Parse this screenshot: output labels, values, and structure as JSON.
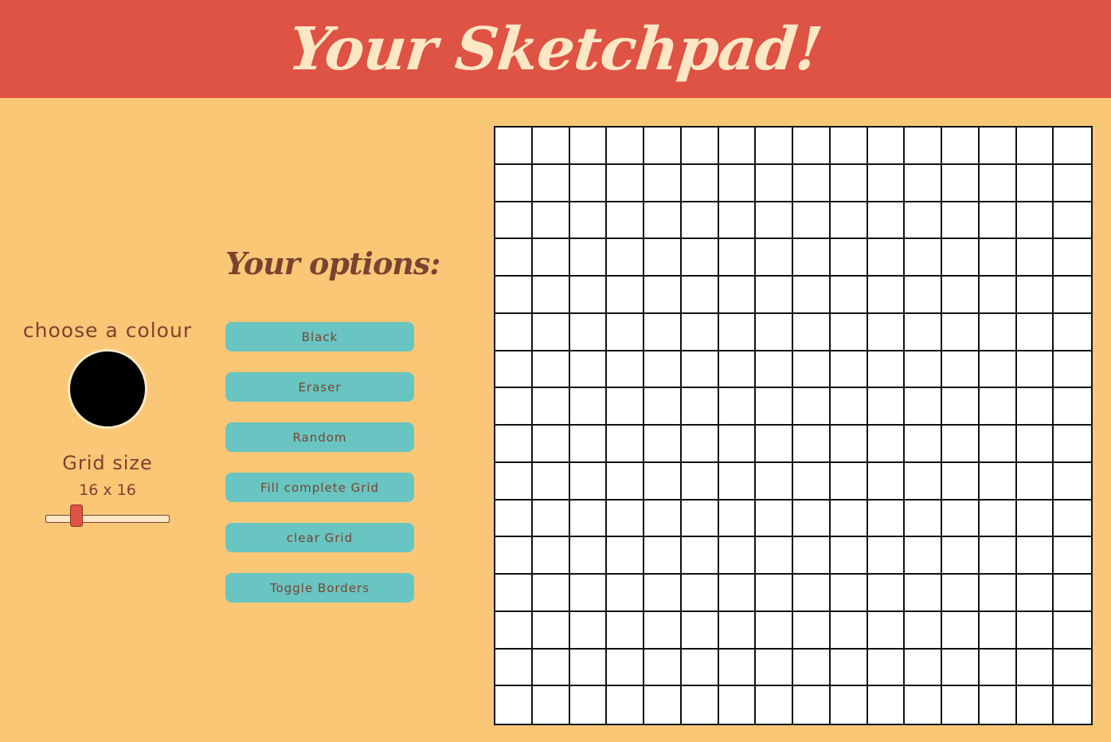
{
  "header": {
    "title": "Your Sketchpad!"
  },
  "colour_picker": {
    "label": "choose a colour",
    "value": "#000000"
  },
  "grid_size": {
    "label": "Grid size",
    "display": "16 x 16",
    "value": 16,
    "min": 1,
    "max": 64
  },
  "options": {
    "title": "Your options:",
    "buttons": [
      {
        "label": "Black"
      },
      {
        "label": "Eraser"
      },
      {
        "label": "Random"
      },
      {
        "label": "Fill complete Grid"
      },
      {
        "label": "clear Grid"
      },
      {
        "label": "Toggle Borders"
      }
    ]
  },
  "sketchpad": {
    "rows": 16,
    "cols": 16,
    "cell_color": "#ffffff",
    "border_color": "#111111"
  },
  "colors": {
    "header_bg": "#de5343",
    "page_bg": "#fac776",
    "button_bg": "#68c5c1",
    "text": "#7a4331",
    "title_text": "#fde7c5"
  }
}
